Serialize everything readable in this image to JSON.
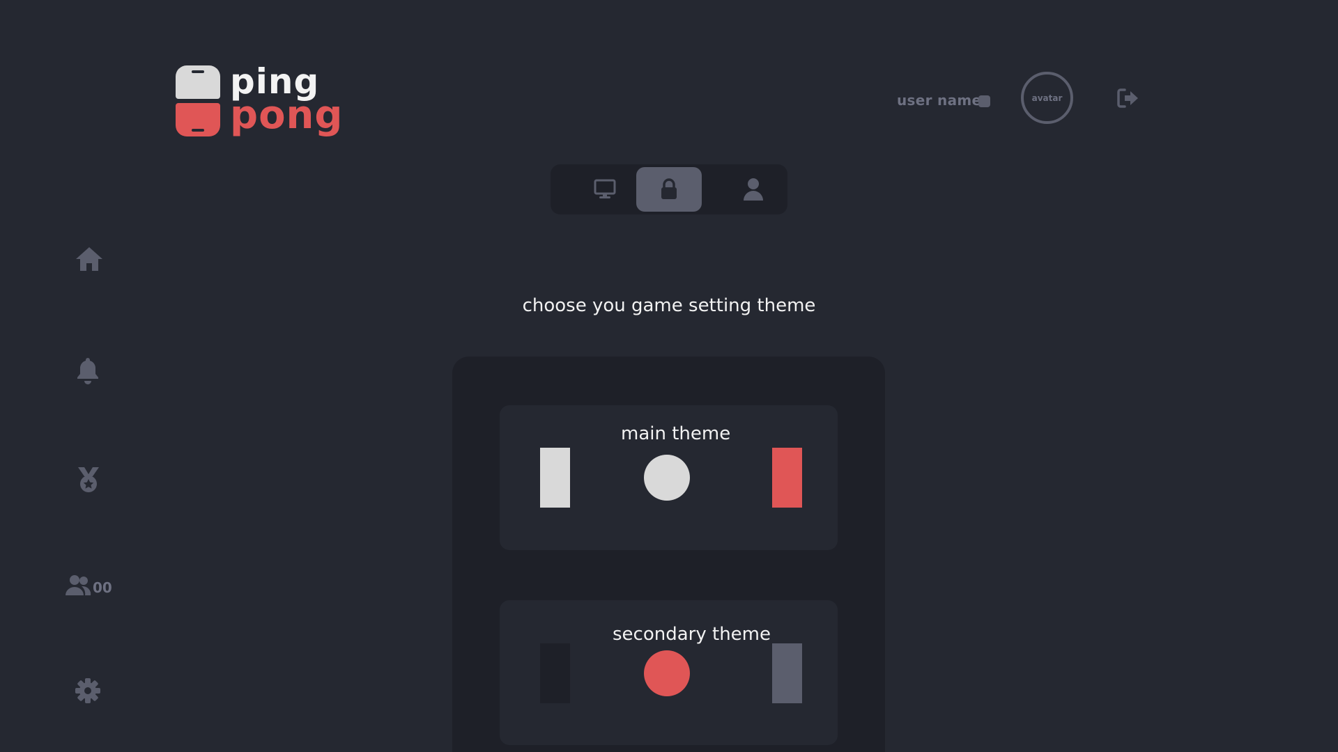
{
  "logo": {
    "word_top": "ping",
    "word_bottom": "pong"
  },
  "header": {
    "username": "user name",
    "avatar_label": "avatar"
  },
  "tabs": [
    {
      "icon": "monitor-icon",
      "active": false
    },
    {
      "icon": "lock-icon",
      "active": true
    },
    {
      "icon": "user-icon",
      "active": false
    }
  ],
  "sidebar": {
    "items": [
      {
        "icon": "home-icon"
      },
      {
        "icon": "bell-icon"
      },
      {
        "icon": "medal-icon"
      },
      {
        "icon": "users-icon",
        "count": "00"
      },
      {
        "icon": "gear-icon"
      }
    ]
  },
  "main": {
    "title": "choose you game setting theme",
    "themes": [
      {
        "label": "main theme",
        "colors": {
          "paddle_left": "#d9d9d9",
          "ball": "#d9d9d9",
          "paddle_right": "#e05656"
        }
      },
      {
        "label": "secondary theme",
        "colors": {
          "paddle_left": "#1e2028",
          "ball": "#e05656",
          "paddle_right": "#5b5e6d"
        }
      }
    ]
  },
  "colors": {
    "background": "#252831",
    "panel": "#1e2028",
    "accent": "#e05656",
    "muted": "#5b5e6d",
    "light": "#d9d9d9"
  }
}
